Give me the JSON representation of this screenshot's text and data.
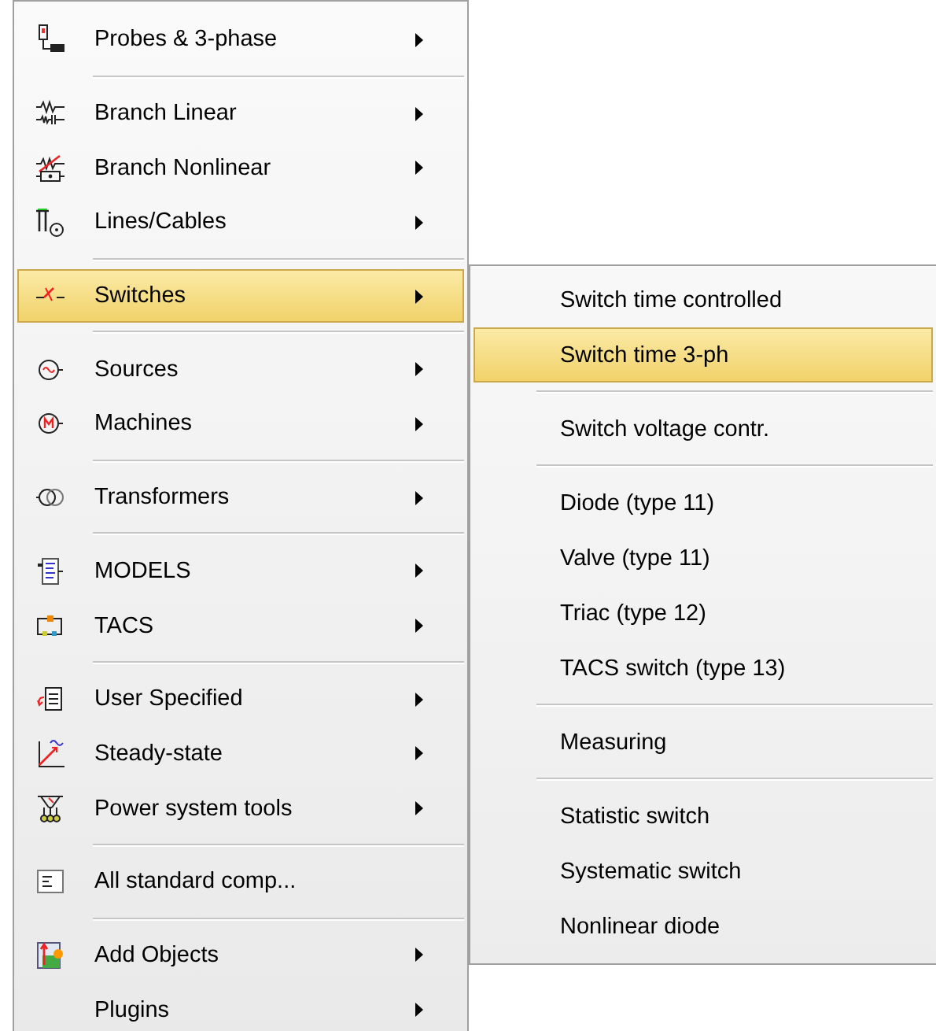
{
  "menu": {
    "items": [
      {
        "kind": "item",
        "label": "Probes & 3-phase",
        "has_submenu": true,
        "selected": false
      },
      {
        "kind": "separator"
      },
      {
        "kind": "item",
        "label": "Branch Linear",
        "has_submenu": true,
        "selected": false
      },
      {
        "kind": "item",
        "label": "Branch Nonlinear",
        "has_submenu": true,
        "selected": false
      },
      {
        "kind": "item",
        "label": "Lines/Cables",
        "has_submenu": true,
        "selected": false
      },
      {
        "kind": "separator"
      },
      {
        "kind": "item",
        "label": "Switches",
        "has_submenu": true,
        "selected": true
      },
      {
        "kind": "separator"
      },
      {
        "kind": "item",
        "label": "Sources",
        "has_submenu": true,
        "selected": false
      },
      {
        "kind": "item",
        "label": "Machines",
        "has_submenu": true,
        "selected": false
      },
      {
        "kind": "separator"
      },
      {
        "kind": "item",
        "label": "Transformers",
        "has_submenu": true,
        "selected": false
      },
      {
        "kind": "separator"
      },
      {
        "kind": "item",
        "label": "MODELS",
        "has_submenu": true,
        "selected": false
      },
      {
        "kind": "item",
        "label": "TACS",
        "has_submenu": true,
        "selected": false
      },
      {
        "kind": "separator"
      },
      {
        "kind": "item",
        "label": "User Specified",
        "has_submenu": true,
        "selected": false
      },
      {
        "kind": "item",
        "label": "Steady-state",
        "has_submenu": true,
        "selected": false
      },
      {
        "kind": "item",
        "label": "Power system tools",
        "has_submenu": true,
        "selected": false
      },
      {
        "kind": "separator"
      },
      {
        "kind": "item",
        "label": "All standard comp...",
        "has_submenu": false,
        "selected": false
      },
      {
        "kind": "separator"
      },
      {
        "kind": "item",
        "label": "Add Objects",
        "has_submenu": true,
        "selected": false
      },
      {
        "kind": "item",
        "label": "Plugins",
        "has_submenu": true,
        "selected": false
      }
    ]
  },
  "submenu": {
    "items": [
      {
        "kind": "item",
        "label": "Switch time controlled",
        "selected": false
      },
      {
        "kind": "item",
        "label": "Switch time 3-ph",
        "selected": true
      },
      {
        "kind": "separator"
      },
      {
        "kind": "item",
        "label": "Switch voltage contr.",
        "selected": false
      },
      {
        "kind": "separator"
      },
      {
        "kind": "item",
        "label": "Diode (type 11)",
        "selected": false
      },
      {
        "kind": "item",
        "label": "Valve (type 11)",
        "selected": false
      },
      {
        "kind": "item",
        "label": "Triac (type 12)",
        "selected": false
      },
      {
        "kind": "item",
        "label": "TACS switch (type 13)",
        "selected": false
      },
      {
        "kind": "separator"
      },
      {
        "kind": "item",
        "label": "Measuring",
        "selected": false
      },
      {
        "kind": "separator"
      },
      {
        "kind": "item",
        "label": "Statistic switch",
        "selected": false
      },
      {
        "kind": "item",
        "label": "Systematic switch",
        "selected": false
      },
      {
        "kind": "item",
        "label": "Nonlinear diode",
        "selected": false
      }
    ]
  }
}
